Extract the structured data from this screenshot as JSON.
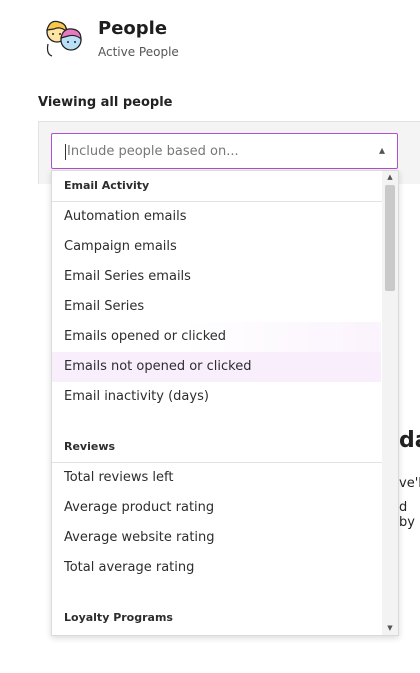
{
  "header": {
    "title": "People",
    "subtitle": "Active People"
  },
  "section": {
    "label": "Viewing all people"
  },
  "filter": {
    "placeholder": "Include people based on...",
    "chevron": "▴"
  },
  "dropdown": {
    "groups": [
      {
        "title": "Email Activity",
        "options": [
          "Automation emails",
          "Campaign emails",
          "Email Series emails",
          "Email Series",
          "Emails opened or clicked",
          "Emails not opened or clicked",
          "Email inactivity (days)"
        ]
      },
      {
        "title": "Reviews",
        "options": [
          "Total reviews left",
          "Average product rating",
          "Average website rating",
          "Total average rating"
        ]
      },
      {
        "title": "Loyalty Programs",
        "options": []
      }
    ],
    "scroll_up": "▲",
    "scroll_down": "▼"
  },
  "background_fragments": {
    "heading": "da",
    "line1": "ve'll",
    "line2": "d by"
  },
  "colors": {
    "accent_border": "#b04fd0",
    "hover_bg": "#f9eefc",
    "panel_bg": "#f4f4f4"
  }
}
